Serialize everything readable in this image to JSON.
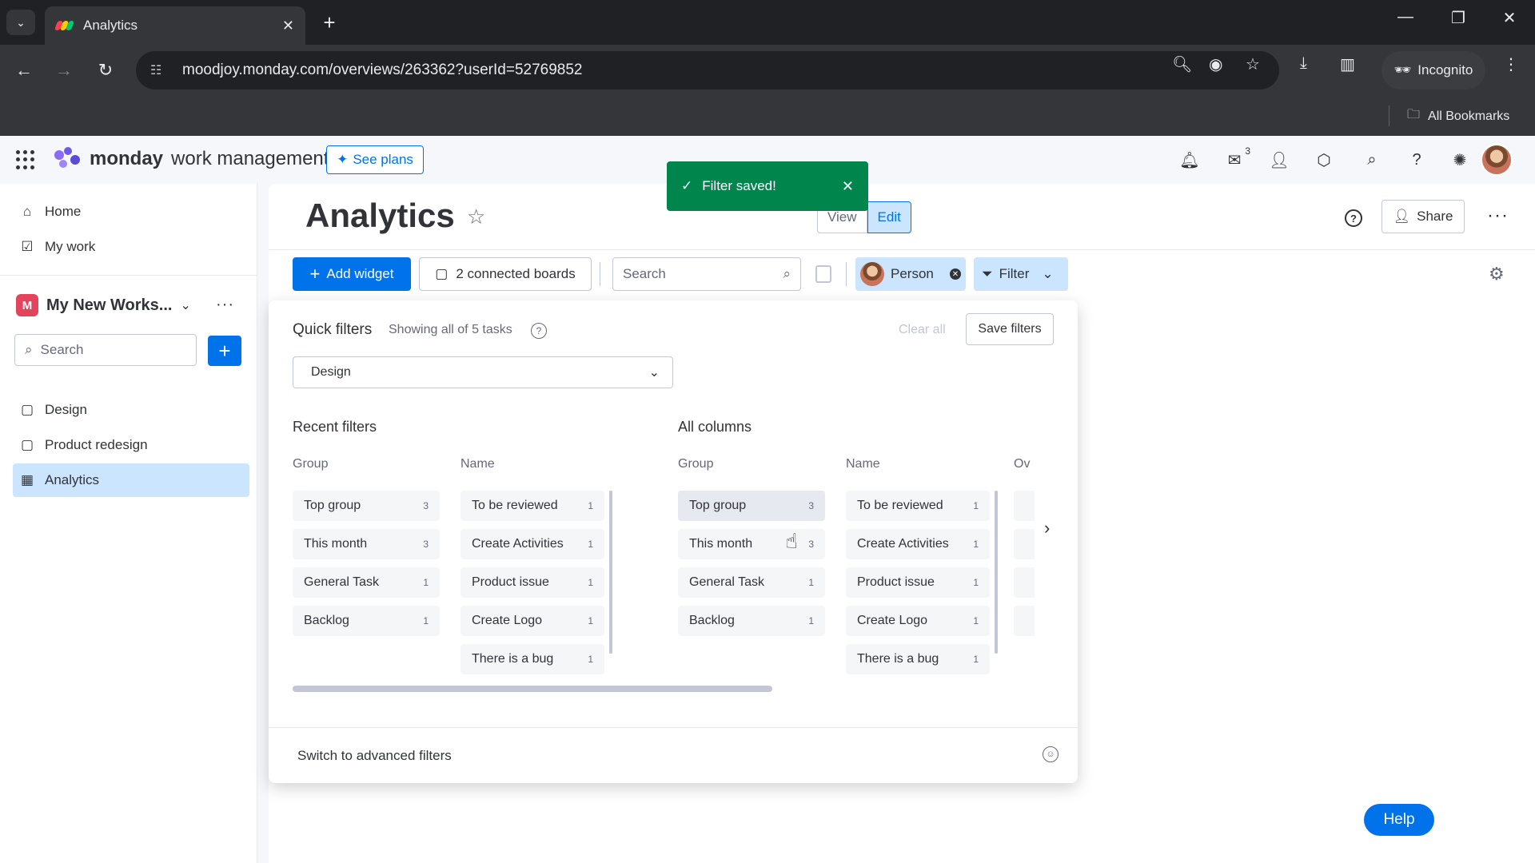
{
  "browser": {
    "tab_title": "Analytics",
    "url": "moodjoy.monday.com/overviews/263362?userId=52769852",
    "incognito_label": "Incognito",
    "bookmarks_label": "All Bookmarks"
  },
  "app": {
    "brand": "monday",
    "product": "work management",
    "see_plans": "See plans",
    "inbox_badge": "3"
  },
  "sidebar": {
    "home": "Home",
    "my_work": "My work",
    "workspace": "My New Works...",
    "search_placeholder": "Search",
    "boards": [
      "Design",
      "Product redesign",
      "Analytics"
    ]
  },
  "main": {
    "title": "Analytics",
    "view": "View",
    "edit": "Edit",
    "share": "Share",
    "add_widget": "Add widget",
    "connected_boards": "2 connected boards",
    "search_placeholder": "Search",
    "person": "Person",
    "filter": "Filter"
  },
  "toast": {
    "text": "Filter saved!"
  },
  "filters": {
    "title": "Quick filters",
    "subtitle": "Showing all of 5 tasks",
    "clear_all": "Clear all",
    "save": "Save filters",
    "board_select": "Design",
    "recent_title": "Recent filters",
    "all_columns_title": "All columns",
    "col_group": "Group",
    "col_name": "Name",
    "col_other": "Ov",
    "groups": [
      {
        "label": "Top group",
        "count": "3"
      },
      {
        "label": "This month",
        "count": "3"
      },
      {
        "label": "General Task",
        "count": "1"
      },
      {
        "label": "Backlog",
        "count": "1"
      }
    ],
    "names": [
      {
        "label": "To be reviewed",
        "count": "1"
      },
      {
        "label": "Create Activities",
        "count": "1"
      },
      {
        "label": "Product issue",
        "count": "1"
      },
      {
        "label": "Create Logo",
        "count": "1"
      },
      {
        "label": "There is a bug",
        "count": "1"
      }
    ],
    "advanced": "Switch to advanced filters"
  },
  "help": "Help",
  "colors": {
    "accent": "#0073ea",
    "success": "#00854d",
    "selected": "#cce5ff"
  }
}
